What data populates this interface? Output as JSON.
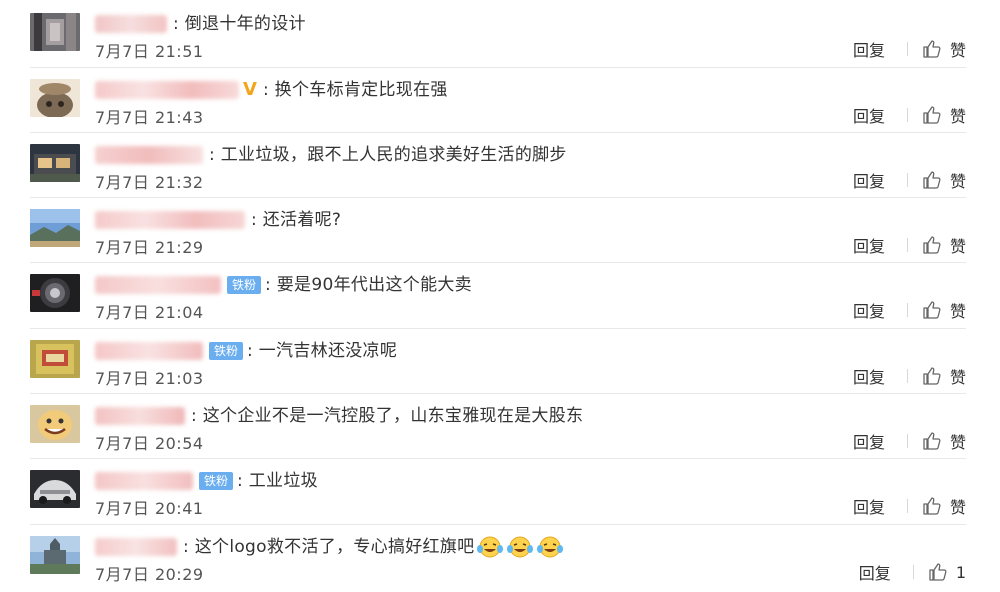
{
  "comments": [
    {
      "text": "倒退十年的设计",
      "date": "7月7日 21:51",
      "reply": "回复",
      "like": "赞",
      "badge": "",
      "vip": ""
    },
    {
      "text": "换个车标肯定比现在强",
      "date": "7月7日 21:43",
      "reply": "回复",
      "like": "赞",
      "badge": "",
      "vip": "V"
    },
    {
      "text": "工业垃圾，跟不上人民的追求美好生活的脚步",
      "date": "7月7日 21:32",
      "reply": "回复",
      "like": "赞",
      "badge": "",
      "vip": ""
    },
    {
      "text": "还活着呢?",
      "date": "7月7日 21:29",
      "reply": "回复",
      "like": "赞",
      "badge": "",
      "vip": ""
    },
    {
      "text": "要是90年代出这个能大卖",
      "date": "7月7日 21:04",
      "reply": "回复",
      "like": "赞",
      "badge": "铁粉",
      "vip": ""
    },
    {
      "text": "一汽吉林还没凉呢",
      "date": "7月7日 21:03",
      "reply": "回复",
      "like": "赞",
      "badge": "铁粉",
      "vip": ""
    },
    {
      "text": "这个企业不是一汽控股了，山东宝雅现在是大股东",
      "date": "7月7日 20:54",
      "reply": "回复",
      "like": "赞",
      "badge": "",
      "vip": ""
    },
    {
      "text": "工业垃圾",
      "date": "7月7日 20:41",
      "reply": "回复",
      "like": "赞",
      "badge": "铁粉",
      "vip": ""
    },
    {
      "text": "这个logo救不活了，专心搞好红旗吧",
      "date": "7月7日 20:29",
      "reply": "回复",
      "like": "1",
      "badge": "",
      "vip": ""
    }
  ],
  "colon": ":",
  "colors": {
    "badge": "#6aaef0",
    "vip": "#f2a51a",
    "text": "#333333",
    "divider": "#e8e8e8"
  },
  "icons": {
    "like": "thumbs-up-icon",
    "emoji": "laugh-cry-emoji-icon"
  }
}
